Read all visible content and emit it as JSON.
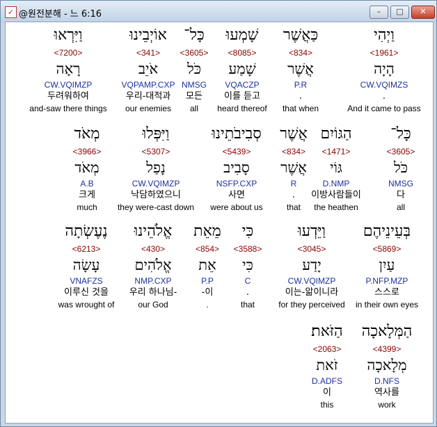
{
  "window": {
    "title": "@원전분해 - 느 6:16",
    "icon": "app-icon",
    "min_label": "–",
    "max_label": "□",
    "close_label": "✕"
  },
  "rows": [
    {
      "cells": [
        {
          "heb": "וַיְהִי",
          "strong": "<1961>",
          "lemma": "הָיָה",
          "morph": "CW.VQIMZS",
          "kor": ".",
          "eng": "And it came to pass"
        },
        {
          "heb": "כַּאֲשֶׁר",
          "strong": "<834>",
          "lemma": "אֲשֶׁר",
          "morph": "P.R",
          "kor": ".",
          "eng": "that when"
        },
        {
          "heb": "שָׁמְעוּ",
          "strong": "<8085>",
          "lemma": "שָׁמַע",
          "morph": "VQACZP",
          "kor": "이를 듣고",
          "eng": "heard thereof"
        },
        {
          "heb": "כָּל־",
          "strong": "<3605>",
          "lemma": "כֹּל",
          "morph": "NMSG",
          "kor": "모든",
          "eng": "all"
        },
        {
          "heb": "אוֹיְבֵינוּ",
          "strong": "<341>",
          "lemma": "אֹיֵב",
          "morph": "VQPAMP.CXP",
          "kor": "우리-대적과",
          "eng": "our enemies"
        },
        {
          "heb": "וַיִּרְאוּ",
          "strong": "<7200>",
          "lemma": "רָאָה",
          "morph": "CW.VQIMZP",
          "kor": "두려워하여",
          "eng": "and-saw there things"
        }
      ]
    },
    {
      "cells": [
        {
          "heb": "כָּל־",
          "strong": "<3605>",
          "lemma": "כֹּל",
          "morph": "NMSG",
          "kor": "다",
          "eng": "all"
        },
        {
          "heb": "הַגּוֹיִם",
          "strong": "<1471>",
          "lemma": "גּוֹי",
          "morph": "D.NMP",
          "kor": "이방사람들이",
          "eng": "the heathen"
        },
        {
          "heb": "אֲשֶׁר",
          "strong": "<834>",
          "lemma": "אֲשֶׁר",
          "morph": "R",
          "kor": ".",
          "eng": "that"
        },
        {
          "heb": "סְבִיבֹתֵינוּ",
          "strong": "<5439>",
          "lemma": "סָבִיב",
          "morph": "NSFP.CXP",
          "kor": "사면",
          "eng": "were about us"
        },
        {
          "heb": "וַיִּפְּלוּ",
          "strong": "<5307>",
          "lemma": "נָפַל",
          "morph": "CW.VQIMZP",
          "kor": "낙담하였으니",
          "eng": "they were-cast down"
        },
        {
          "heb": "מְאֹד",
          "strong": "<3966>",
          "lemma": "מְאֹד",
          "morph": "A.B",
          "kor": "크게",
          "eng": "much"
        }
      ]
    },
    {
      "cells": [
        {
          "heb": "בְּעֵינֵיהֶם",
          "strong": "<5869>",
          "lemma": "עַיִן",
          "morph": "P.NFP.MZP",
          "kor": "스스로",
          "eng": "in their own eyes"
        },
        {
          "heb": "וַיֵּדְעוּ",
          "strong": "<3045>",
          "lemma": "יָדַע",
          "morph": "CW.VQIMZP",
          "kor": "이는-앎이니라",
          "eng": "for they perceived"
        },
        {
          "heb": "כִּי",
          "strong": "<3588>",
          "lemma": "כִּי",
          "morph": "C",
          "kor": ".",
          "eng": "that"
        },
        {
          "heb": "מֵאֵת",
          "strong": "<854>",
          "lemma": "אֵת",
          "morph": "P.P",
          "kor": "-이",
          "eng": "."
        },
        {
          "heb": "אֱלֹהֵינוּ",
          "strong": "<430>",
          "lemma": "אֱלֹהִים",
          "morph": "NMP.CXP",
          "kor": "우리 하나님-",
          "eng": "our God"
        },
        {
          "heb": "נֶעֶשְׂתָה",
          "strong": "<6213>",
          "lemma": "עָשָׂה",
          "morph": "VNAFZS",
          "kor": "이루신 것을",
          "eng": "was wrought of"
        }
      ]
    },
    {
      "cells": [
        {
          "heb": "הַמְּלָאכָה",
          "strong": "<4399>",
          "lemma": "מְלָאכָה",
          "morph": "D.NFS",
          "kor": "역사를",
          "eng": "work"
        },
        {
          "heb": "הַזֹּאת׃",
          "strong": "<2063>",
          "lemma": "זֹאת",
          "morph": "D.ADFS",
          "kor": "이",
          "eng": "this"
        }
      ]
    }
  ]
}
